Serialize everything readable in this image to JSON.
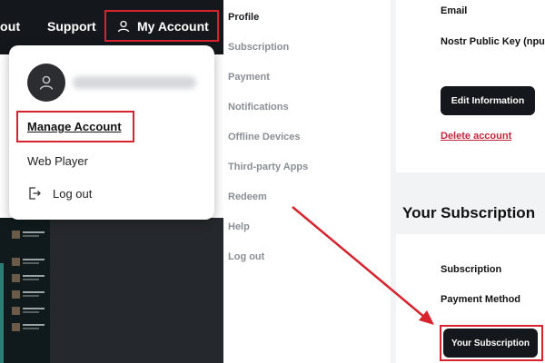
{
  "header": {
    "about_label": "out",
    "support_label": "Support",
    "my_account_label": "My Account"
  },
  "dropdown": {
    "manage_account_label": "Manage Account",
    "web_player_label": "Web Player",
    "log_out_label": "Log out"
  },
  "menu": {
    "items": [
      {
        "label": "Profile",
        "active": true
      },
      {
        "label": "Subscription",
        "active": false
      },
      {
        "label": "Payment",
        "active": false
      },
      {
        "label": "Notifications",
        "active": false
      },
      {
        "label": "Offline Devices",
        "active": false
      },
      {
        "label": "Third-party Apps",
        "active": false
      },
      {
        "label": "Redeem",
        "active": false
      },
      {
        "label": "Help",
        "active": false
      },
      {
        "label": "Log out",
        "active": false
      }
    ]
  },
  "profile_card": {
    "email_label": "Email",
    "nostr_label": "Nostr Public Key (npu",
    "edit_button_label": "Edit Information",
    "delete_link_label": "Delete account"
  },
  "subscription_section": {
    "heading": "Your Subscription",
    "subscription_label": "Subscription",
    "payment_method_label": "Payment Method",
    "button_label": "Your Subscription"
  },
  "colors": {
    "highlight_red": "#d8232f",
    "dark_header": "#14171b",
    "delete_red": "#c8243c"
  }
}
